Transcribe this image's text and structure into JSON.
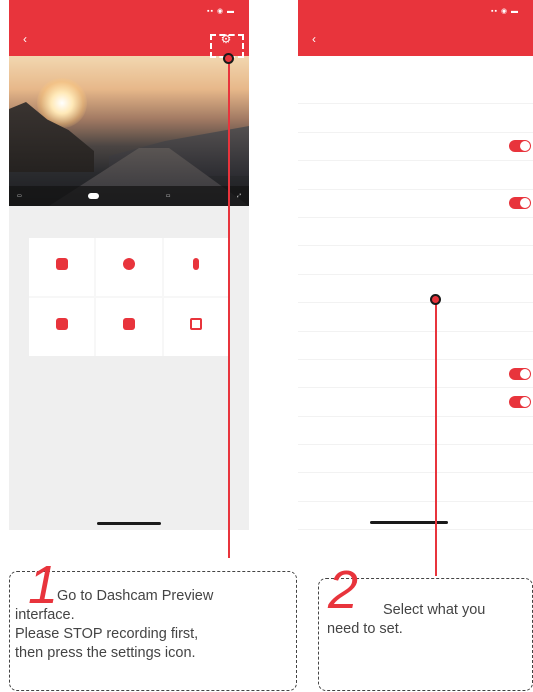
{
  "steps": [
    {
      "number": "1",
      "line1": "Go to Dashcam Preview",
      "line2": "interface.",
      "line3": "Please STOP recording first,",
      "line4": "then press the settings icon."
    },
    {
      "number": "2",
      "line1": "Select what you",
      "line2": "need to set."
    }
  ],
  "colors": {
    "accent": "#e8343c",
    "text": "#444444"
  },
  "icons": {
    "settings": "gear-icon",
    "back": "chevron-left-icon"
  }
}
